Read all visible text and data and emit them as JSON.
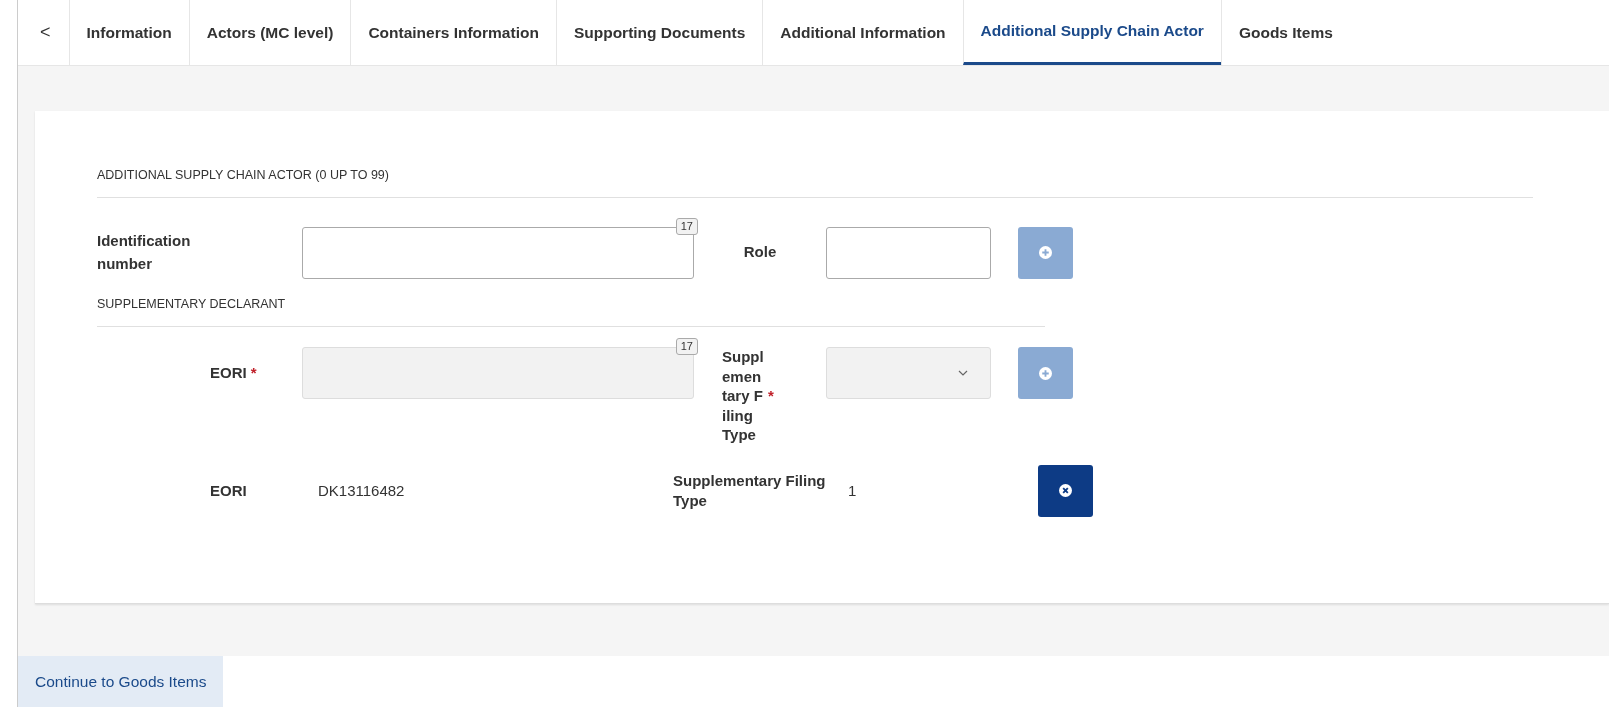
{
  "tab_scroll": {
    "label": "<"
  },
  "tabs": [
    {
      "label": "Information",
      "selected": false
    },
    {
      "label": "Actors (MC level)",
      "selected": false
    },
    {
      "label": "Containers Information",
      "selected": false
    },
    {
      "label": "Supporting Documents",
      "selected": false
    },
    {
      "label": "Additional Information",
      "selected": false
    },
    {
      "label": "Additional Supply Chain Actor",
      "selected": true
    },
    {
      "label": "Goods Items",
      "selected": false
    }
  ],
  "section": {
    "title": "ADDITIONAL SUPPLY CHAIN ACTOR (0 UP TO 99)",
    "identification": {
      "label": "Identification number",
      "counter": "17",
      "disabled": false
    },
    "role": {
      "label": "Role",
      "disabled": false
    },
    "add_button": {
      "disabled": true
    }
  },
  "subsection": {
    "title": "SUPPLEMENTARY DECLARANT",
    "eori": {
      "label": "EORI",
      "required_mark": "*",
      "counter": "17",
      "disabled": true
    },
    "filing_type": {
      "label": "Supplementary Filing Type",
      "required_mark": "*",
      "disabled": true
    },
    "add_button": {
      "disabled": true
    },
    "entries": [
      {
        "eori_label": "EORI",
        "eori": "DK13116482",
        "type_label": "Supplementary Filing Type",
        "type": "1"
      }
    ]
  },
  "continue_button": {
    "label": "Continue to Goods Items"
  }
}
